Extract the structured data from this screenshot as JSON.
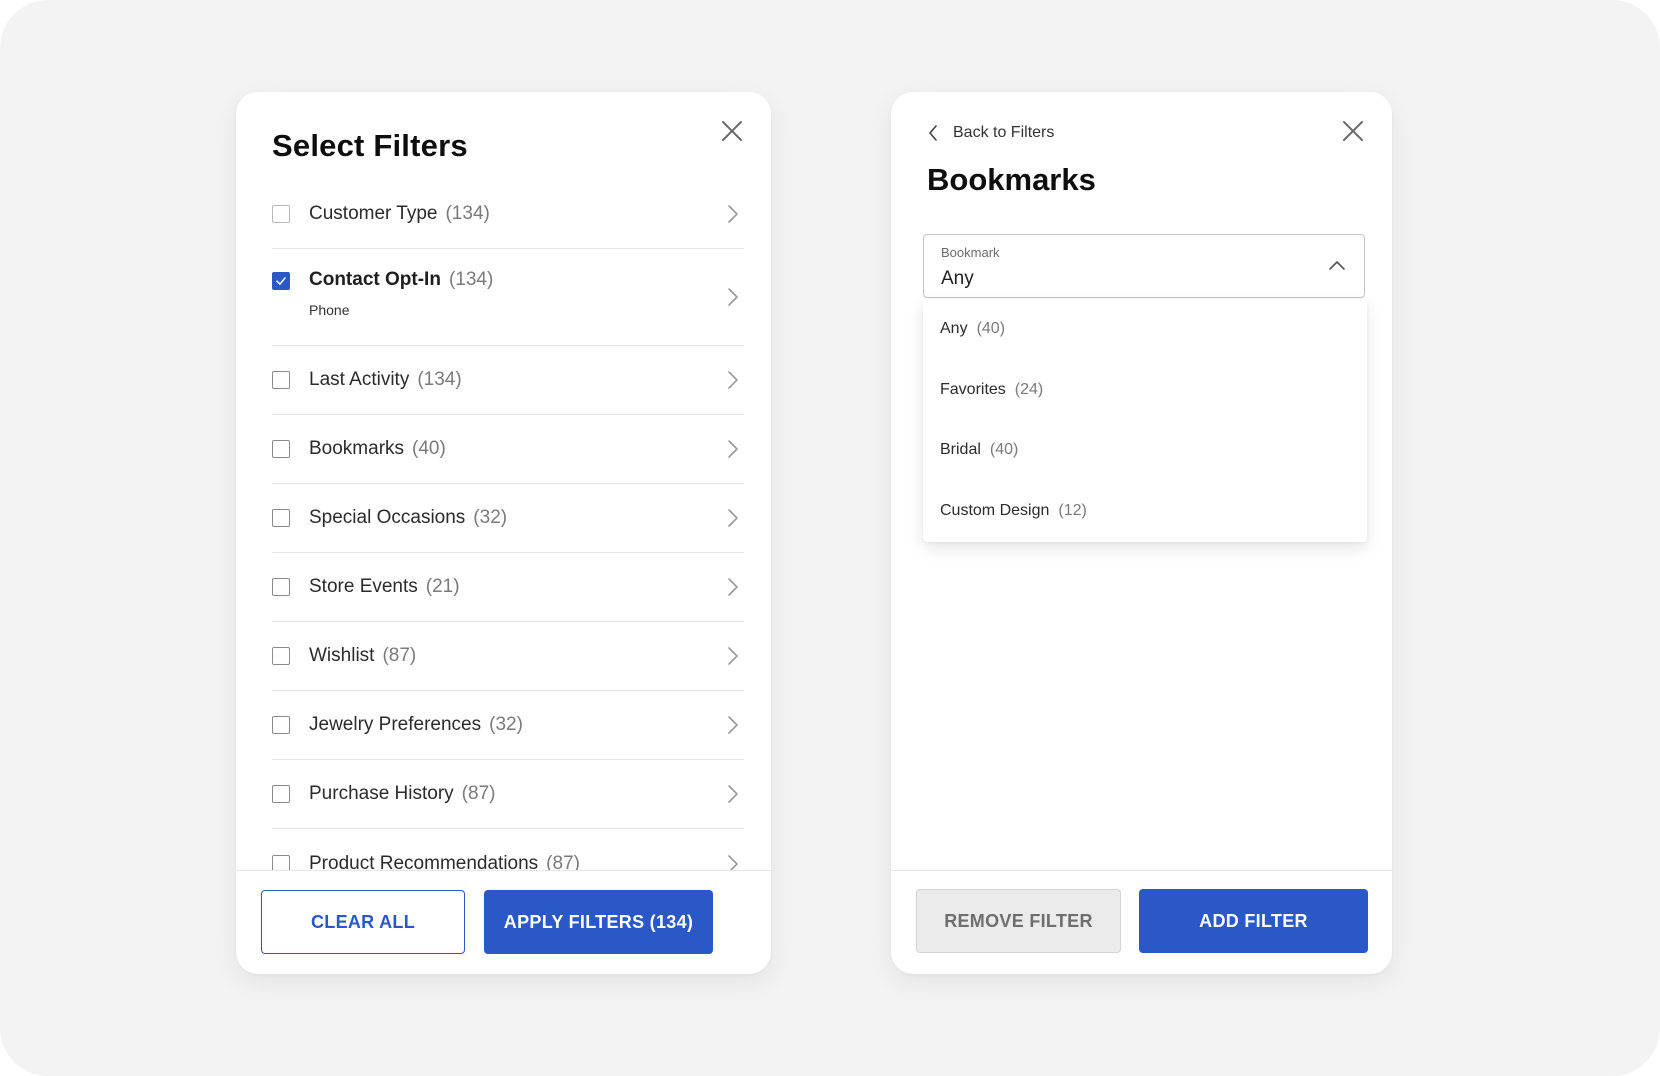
{
  "colors": {
    "primary": "#2a58c6",
    "background": "#f3f3f3",
    "card": "#ffffff",
    "divider": "#e6e6e6",
    "muted_text": "#7a7a7a",
    "disabled_button": "#ebebeb"
  },
  "filters_panel": {
    "title": "Select Filters",
    "close_icon": "close-icon",
    "items": [
      {
        "label": "Customer Type",
        "count": "(134)",
        "checked": false,
        "sublabel": ""
      },
      {
        "label": "Contact Opt-In",
        "count": "(134)",
        "checked": true,
        "sublabel": "Phone"
      },
      {
        "label": "Last Activity",
        "count": "(134)",
        "checked": false,
        "sublabel": ""
      },
      {
        "label": "Bookmarks",
        "count": "(40)",
        "checked": false,
        "sublabel": ""
      },
      {
        "label": "Special Occasions",
        "count": "(32)",
        "checked": false,
        "sublabel": ""
      },
      {
        "label": "Store Events",
        "count": "(21)",
        "checked": false,
        "sublabel": ""
      },
      {
        "label": "Wishlist",
        "count": "(87)",
        "checked": false,
        "sublabel": ""
      },
      {
        "label": "Jewelry Preferences",
        "count": "(32)",
        "checked": false,
        "sublabel": ""
      },
      {
        "label": "Purchase History",
        "count": "(87)",
        "checked": false,
        "sublabel": ""
      },
      {
        "label": "Product Recommendations",
        "count": "(87)",
        "checked": false,
        "sublabel": ""
      }
    ],
    "clear_label": "CLEAR ALL",
    "apply_label": "APPLY FILTERS (134)"
  },
  "bookmarks_panel": {
    "back_label": "Back to Filters",
    "title": "Bookmarks",
    "select": {
      "label": "Bookmark",
      "value": "Any",
      "expanded": true
    },
    "options": [
      {
        "label": "Any",
        "count": "(40)"
      },
      {
        "label": "Favorites",
        "count": "(24)"
      },
      {
        "label": "Bridal",
        "count": "(40)"
      },
      {
        "label": "Custom Design",
        "count": "(12)"
      }
    ],
    "remove_label": "REMOVE FILTER",
    "add_label": "ADD FILTER"
  }
}
